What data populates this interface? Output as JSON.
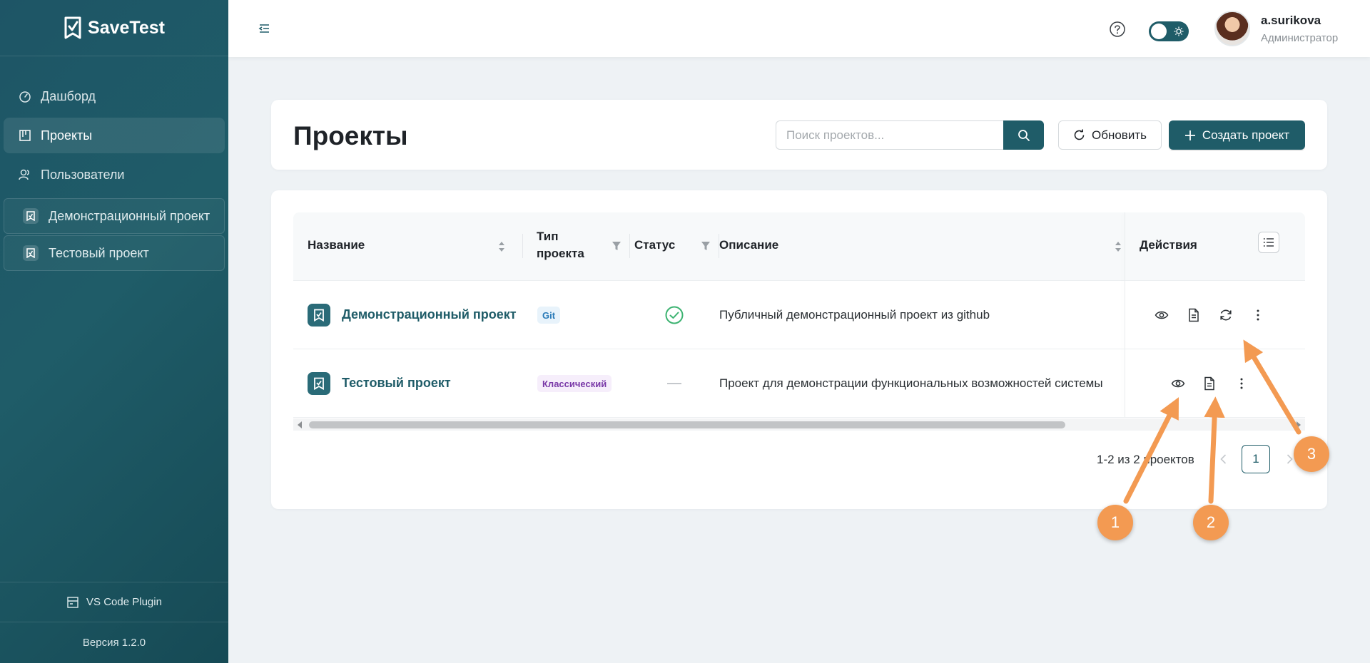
{
  "app": {
    "name": "SaveTest"
  },
  "sidebar": {
    "nav": [
      {
        "label": "Дашборд",
        "icon": "dashboard-icon"
      },
      {
        "label": "Проекты",
        "icon": "projects-icon",
        "active": true
      },
      {
        "label": "Пользователи",
        "icon": "users-icon"
      }
    ],
    "projects": [
      {
        "label": "Демонстрационный проект"
      },
      {
        "label": "Тестовый проект"
      }
    ],
    "plugin_label": "VS Code Plugin",
    "version": "Версия 1.2.0"
  },
  "header": {
    "user": {
      "name": "a.surikova",
      "role": "Администратор"
    }
  },
  "page": {
    "title": "Проекты",
    "search": {
      "placeholder": "Поиск проектов...",
      "value": ""
    },
    "refresh_label": "Обновить",
    "create_label": "Создать проект"
  },
  "table": {
    "columns": {
      "name": "Название",
      "type_line1": "Тип",
      "type_line2": "проекта",
      "status": "Статус",
      "description": "Описание",
      "actions": "Действия"
    },
    "rows": [
      {
        "name": "Демонстрационный проект",
        "type": "Git",
        "status": "ok",
        "description": "Публичный демонстрационный проект из github",
        "actions": [
          "view",
          "report",
          "sync",
          "more"
        ]
      },
      {
        "name": "Тестовый проект",
        "type": "Классический",
        "status": "none",
        "description": "Проект для демонстрации функциональных возможностей системы",
        "actions": [
          "view",
          "report",
          "more"
        ]
      }
    ]
  },
  "pagination": {
    "total_text": "1-2 из 2 проектов",
    "current_page": "1"
  },
  "annotations": [
    {
      "label": "1"
    },
    {
      "label": "2"
    },
    {
      "label": "3"
    }
  ],
  "colors": {
    "accent": "#1f5c68",
    "callout": "#f39a52",
    "success": "#3cb371"
  }
}
